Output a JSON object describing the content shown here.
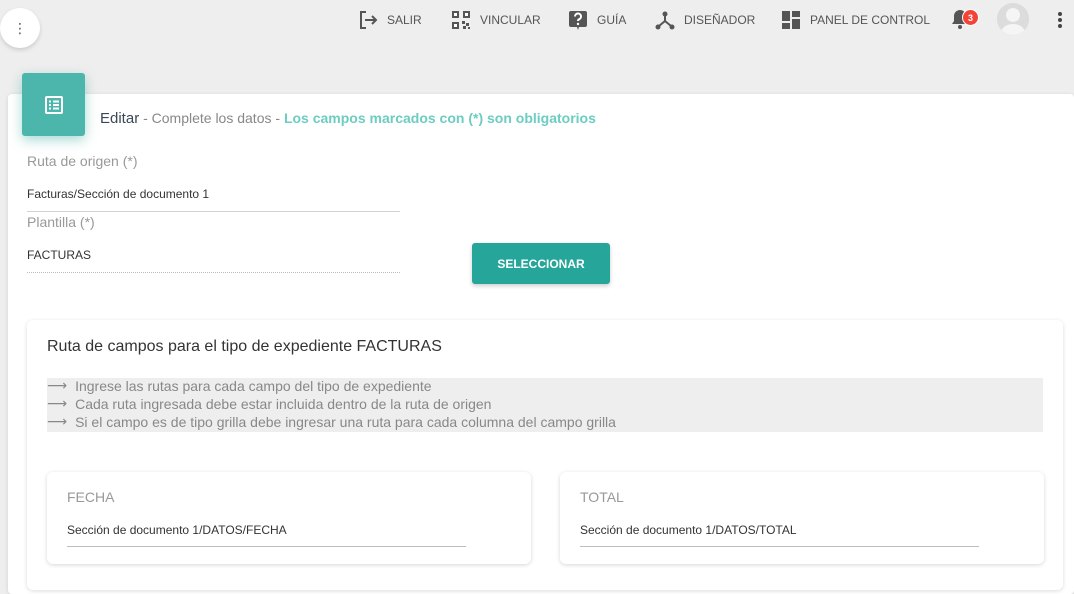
{
  "nav": {
    "items": [
      {
        "label": "SALIR",
        "icon": "logout-icon"
      },
      {
        "label": "VINCULAR",
        "icon": "qr-code-icon"
      },
      {
        "label": "GUÍA",
        "icon": "help-icon"
      },
      {
        "label": "DISEÑADOR",
        "icon": "hierarchy-icon"
      },
      {
        "label": "PANEL DE CONTROL",
        "icon": "dashboard-icon"
      }
    ],
    "notification_count": "3"
  },
  "header": {
    "title": "Editar",
    "sep1": " - ",
    "subtitle": "Complete los datos",
    "sep2": " - ",
    "required_note": "Los campos marcados con (*) son obligatorios"
  },
  "form": {
    "ruta_label": "Ruta de origen (*)",
    "ruta_value": "Facturas/Sección de documento 1",
    "plantilla_label": "Plantilla (*)",
    "plantilla_value": "FACTURAS",
    "select_button": "SELECCIONAR"
  },
  "paths": {
    "title": "Ruta de campos para el tipo de expediente FACTURAS",
    "hints": [
      "Ingrese las rutas para cada campo del tipo de expediente",
      "Cada ruta ingresada debe estar incluida dentro de la ruta de origen",
      "Si el campo es de tipo grilla debe ingresar una ruta para cada columna del campo grilla"
    ],
    "fields": [
      {
        "label": "FECHA",
        "value": "Sección de documento 1/DATOS/FECHA"
      },
      {
        "label": "TOTAL",
        "value": "Sección de documento 1/DATOS/TOTAL"
      }
    ]
  },
  "colors": {
    "accent": "#26a69a",
    "accent_light": "#4db6ac",
    "required_text": "#6ccdc0",
    "badge": "#f44336"
  }
}
